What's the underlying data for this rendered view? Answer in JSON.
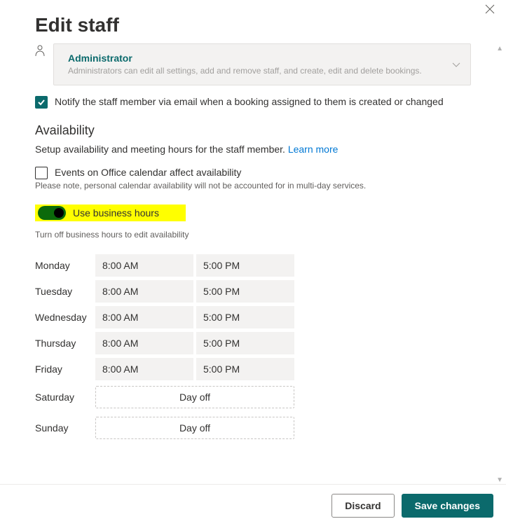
{
  "header": {
    "title": "Edit staff"
  },
  "role": {
    "name": "Administrator",
    "description": "Administrators can edit all settings, add and remove staff, and create, edit and delete bookings."
  },
  "notify": {
    "checked": true,
    "label": "Notify the staff member via email when a booking assigned to them is created or changed"
  },
  "availability": {
    "section_title": "Availability",
    "description": "Setup availability and meeting hours for the staff member. ",
    "learn_more": "Learn more",
    "office_calendar": {
      "checked": false,
      "label": "Events on Office calendar affect availability",
      "note": "Please note, personal calendar availability will not be accounted for in multi-day services."
    },
    "business_hours": {
      "on": true,
      "label": "Use business hours",
      "note": "Turn off business hours to edit availability"
    },
    "schedule": [
      {
        "day": "Monday",
        "type": "hours",
        "start": "8:00 AM",
        "end": "5:00 PM"
      },
      {
        "day": "Tuesday",
        "type": "hours",
        "start": "8:00 AM",
        "end": "5:00 PM"
      },
      {
        "day": "Wednesday",
        "type": "hours",
        "start": "8:00 AM",
        "end": "5:00 PM"
      },
      {
        "day": "Thursday",
        "type": "hours",
        "start": "8:00 AM",
        "end": "5:00 PM"
      },
      {
        "day": "Friday",
        "type": "hours",
        "start": "8:00 AM",
        "end": "5:00 PM"
      },
      {
        "day": "Saturday",
        "type": "dayoff",
        "label": "Day off"
      },
      {
        "day": "Sunday",
        "type": "dayoff",
        "label": "Day off"
      }
    ]
  },
  "footer": {
    "discard": "Discard",
    "save": "Save changes"
  }
}
